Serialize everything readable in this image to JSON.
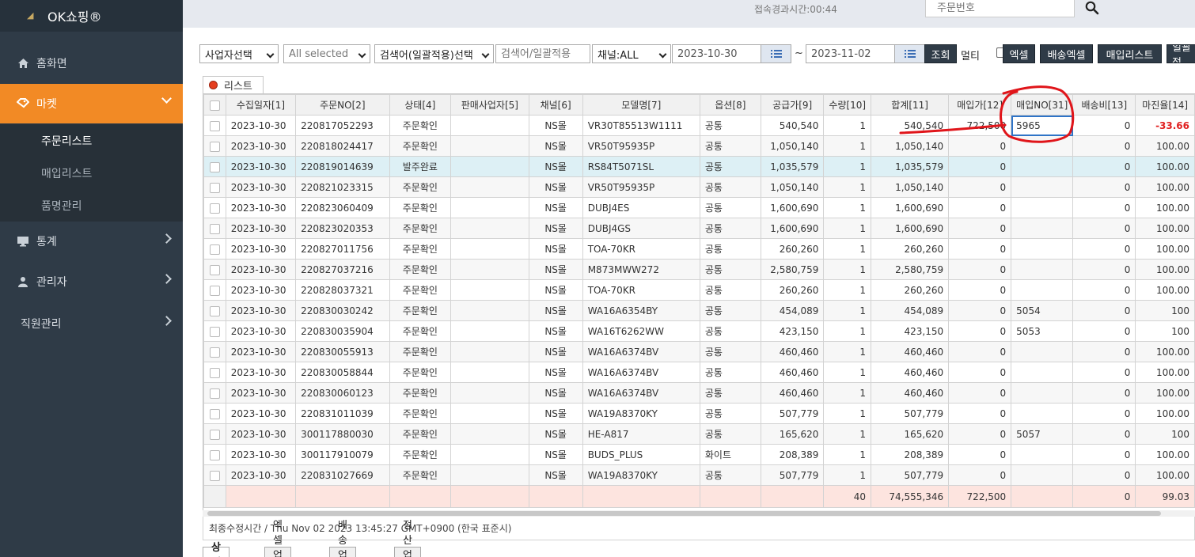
{
  "brand": {
    "label": "OK쇼핑®"
  },
  "sidebar": {
    "items": [
      {
        "label": "홈화면",
        "icon": "home-icon"
      },
      {
        "label": "마켓",
        "icon": "tag-icon"
      },
      {
        "label": "통계",
        "icon": "monitor-icon"
      },
      {
        "label": "관리자",
        "icon": "user-icon"
      },
      {
        "label": "직원관리",
        "icon": ""
      }
    ],
    "submenu": [
      "주문리스트",
      "매입리스트",
      "품명관리"
    ]
  },
  "topbar": {
    "elapsed": "접속경과시간:00:44",
    "search_placeholder": "주문번호"
  },
  "filters": {
    "business": "사업자선택",
    "multi_selected": "All selected",
    "keyword_type": "검색어(일괄적용)선택",
    "keyword_placeholder": "검색어/일괄적용",
    "channel": "채널:ALL",
    "date_from": "2023-10-30",
    "tilde": "~",
    "date_to": "2023-11-02",
    "search_btn": "조회",
    "multi_label": "멀티",
    "excel_btn": "엑셀",
    "ship_excel_btn": "배송엑셀",
    "purchase_list_btn": "매입리스트",
    "bulk_btn": "일괄적"
  },
  "grid": {
    "tab_label": "리스트",
    "columns": [
      "수집일자[1]",
      "주문NO[2]",
      "상태[4]",
      "판매사업자[5]",
      "채널[6]",
      "모델명[7]",
      "옵션[8]",
      "공급가[9]",
      "수량[10]",
      "합계[11]",
      "매입가[12]",
      "매입NO[31]",
      "배송비[13]",
      "마진율[14]"
    ],
    "rows": [
      [
        "2023-10-30",
        "220817052293",
        "주문확인",
        "",
        "NS몰",
        "VR30T85513W1111",
        "공통",
        "540,540",
        "1",
        "540,540",
        "722,500",
        "5965",
        "0",
        "-33.66"
      ],
      [
        "2023-10-30",
        "220818024417",
        "주문확인",
        "",
        "NS몰",
        "VR50T95935P",
        "공통",
        "1,050,140",
        "1",
        "1,050,140",
        "0",
        "",
        "0",
        "100.00"
      ],
      [
        "2023-10-30",
        "220819014639",
        "발주완료",
        "",
        "NS몰",
        "RS84T5071SL",
        "공통",
        "1,035,579",
        "1",
        "1,035,579",
        "0",
        "",
        "0",
        "100.00"
      ],
      [
        "2023-10-30",
        "220821023315",
        "주문확인",
        "",
        "NS몰",
        "VR50T95935P",
        "공통",
        "1,050,140",
        "1",
        "1,050,140",
        "0",
        "",
        "0",
        "100.00"
      ],
      [
        "2023-10-30",
        "220823060409",
        "주문확인",
        "",
        "NS몰",
        "DUBJ4ES",
        "공통",
        "1,600,690",
        "1",
        "1,600,690",
        "0",
        "",
        "0",
        "100.00"
      ],
      [
        "2023-10-30",
        "220823020353",
        "주문확인",
        "",
        "NS몰",
        "DUBJ4GS",
        "공통",
        "1,600,690",
        "1",
        "1,600,690",
        "0",
        "",
        "0",
        "100.00"
      ],
      [
        "2023-10-30",
        "220827011756",
        "주문확인",
        "",
        "NS몰",
        "TOA-70KR",
        "공통",
        "260,260",
        "1",
        "260,260",
        "0",
        "",
        "0",
        "100.00"
      ],
      [
        "2023-10-30",
        "220827037216",
        "주문확인",
        "",
        "NS몰",
        "M873MWW272",
        "공통",
        "2,580,759",
        "1",
        "2,580,759",
        "0",
        "",
        "0",
        "100.00"
      ],
      [
        "2023-10-30",
        "220828037321",
        "주문확인",
        "",
        "NS몰",
        "TOA-70KR",
        "공통",
        "260,260",
        "1",
        "260,260",
        "0",
        "",
        "0",
        "100.00"
      ],
      [
        "2023-10-30",
        "220830030242",
        "주문확인",
        "",
        "NS몰",
        "WA16A6354BY",
        "공통",
        "454,089",
        "1",
        "454,089",
        "0",
        "5054",
        "0",
        "100"
      ],
      [
        "2023-10-30",
        "220830035904",
        "주문확인",
        "",
        "NS몰",
        "WA16T6262WW",
        "공통",
        "423,150",
        "1",
        "423,150",
        "0",
        "5053",
        "0",
        "100"
      ],
      [
        "2023-10-30",
        "220830055913",
        "주문확인",
        "",
        "NS몰",
        "WA16A6374BV",
        "공통",
        "460,460",
        "1",
        "460,460",
        "0",
        "",
        "0",
        "100.00"
      ],
      [
        "2023-10-30",
        "220830058844",
        "주문확인",
        "",
        "NS몰",
        "WA16A6374BV",
        "공통",
        "460,460",
        "1",
        "460,460",
        "0",
        "",
        "0",
        "100.00"
      ],
      [
        "2023-10-30",
        "220830060123",
        "주문확인",
        "",
        "NS몰",
        "WA16A6374BV",
        "공통",
        "460,460",
        "1",
        "460,460",
        "0",
        "",
        "0",
        "100.00"
      ],
      [
        "2023-10-30",
        "220831011039",
        "주문확인",
        "",
        "NS몰",
        "WA19A8370KY",
        "공통",
        "507,779",
        "1",
        "507,779",
        "0",
        "",
        "0",
        "100.00"
      ],
      [
        "2023-10-30",
        "300117880030",
        "주문확인",
        "",
        "NS몰",
        "HE-A817",
        "공통",
        "165,620",
        "1",
        "165,620",
        "0",
        "5057",
        "0",
        "100"
      ],
      [
        "2023-10-30",
        "300117910079",
        "주문확인",
        "",
        "NS몰",
        "BUDS_PLUS",
        "화이트",
        "208,389",
        "1",
        "208,389",
        "0",
        "",
        "0",
        "100.00"
      ],
      [
        "2023-10-30",
        "220831027669",
        "주문확인",
        "",
        "NS몰",
        "WA19A8370KY",
        "공통",
        "507,779",
        "1",
        "507,779",
        "0",
        "",
        "0",
        "100.00"
      ]
    ],
    "highlight_row": 2,
    "summary": [
      "",
      "",
      "",
      "",
      "",
      "",
      "",
      "",
      "40",
      "74,555,346",
      "722,500",
      "",
      "0",
      "99.03"
    ]
  },
  "footer": {
    "last_modified": "최종수정시간 / Thu Nov 02 2023 13:45:27 GMT+0900 (한국 표준시)",
    "tabs": [
      "상세",
      "엑셀업로드",
      "배송업로드",
      "정산업로드"
    ]
  }
}
